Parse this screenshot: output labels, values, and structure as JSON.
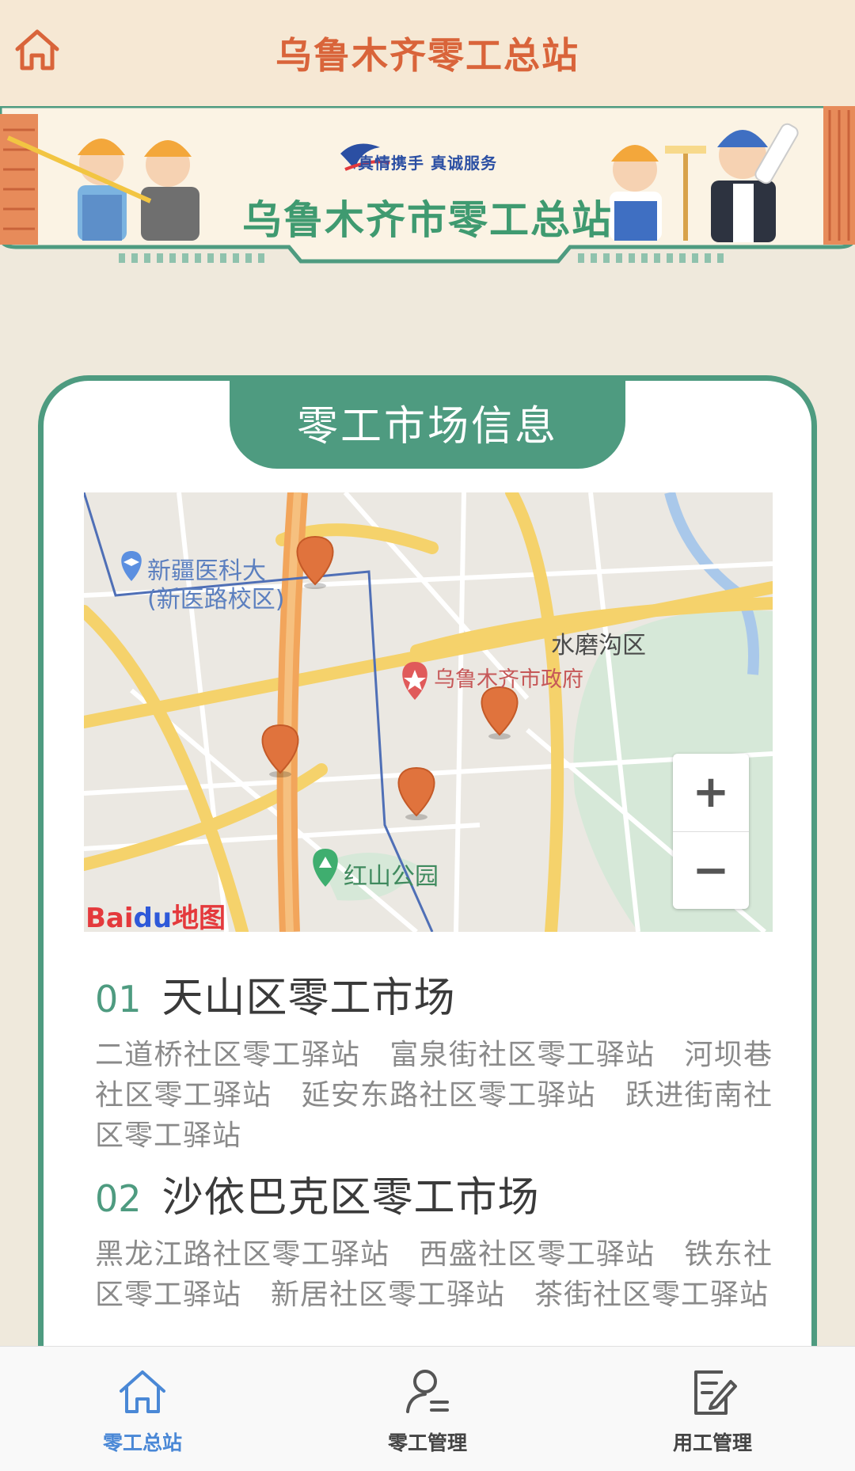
{
  "header": {
    "title": "乌鲁木齐零工总站",
    "home_icon": "home-icon"
  },
  "banner": {
    "slogan": "真情携手 真诚服务",
    "title": "乌鲁木齐市零工总站"
  },
  "section": {
    "title": "零工市场信息"
  },
  "map": {
    "labels": {
      "poi_university": "新疆医科大",
      "poi_university_sub": "(新医路校区)",
      "district": "水磨沟区",
      "gov": "乌鲁木齐市政府",
      "park": "红山公园"
    },
    "zoom_in": "+",
    "zoom_out": "−",
    "logo_bai": "Bai",
    "logo_du": "du",
    "logo_map": "地图",
    "marker_color": "#e0733d"
  },
  "markets": [
    {
      "num": "01",
      "name": "天山区零工市场",
      "stations": "二道桥社区零工驿站　富泉街社区零工驿站　河坝巷社区零工驿站　延安东路社区零工驿站　跃进街南社区零工驿站"
    },
    {
      "num": "02",
      "name": "沙依巴克区零工市场",
      "stations": "黑龙江路社区零工驿站　西盛社区零工驿站　铁东社区零工驿站　新居社区零工驿站　茶街社区零工驿站"
    }
  ],
  "nav": {
    "items": [
      {
        "label": "零工总站",
        "icon": "home-icon",
        "active": true
      },
      {
        "label": "零工管理",
        "icon": "user-list-icon",
        "active": false
      },
      {
        "label": "用工管理",
        "icon": "edit-document-icon",
        "active": false
      }
    ],
    "active_color": "#4a88d6"
  },
  "colors": {
    "accent_green": "#4e9b80",
    "title_orange": "#d9643a",
    "header_bg": "#f6e8d4"
  }
}
